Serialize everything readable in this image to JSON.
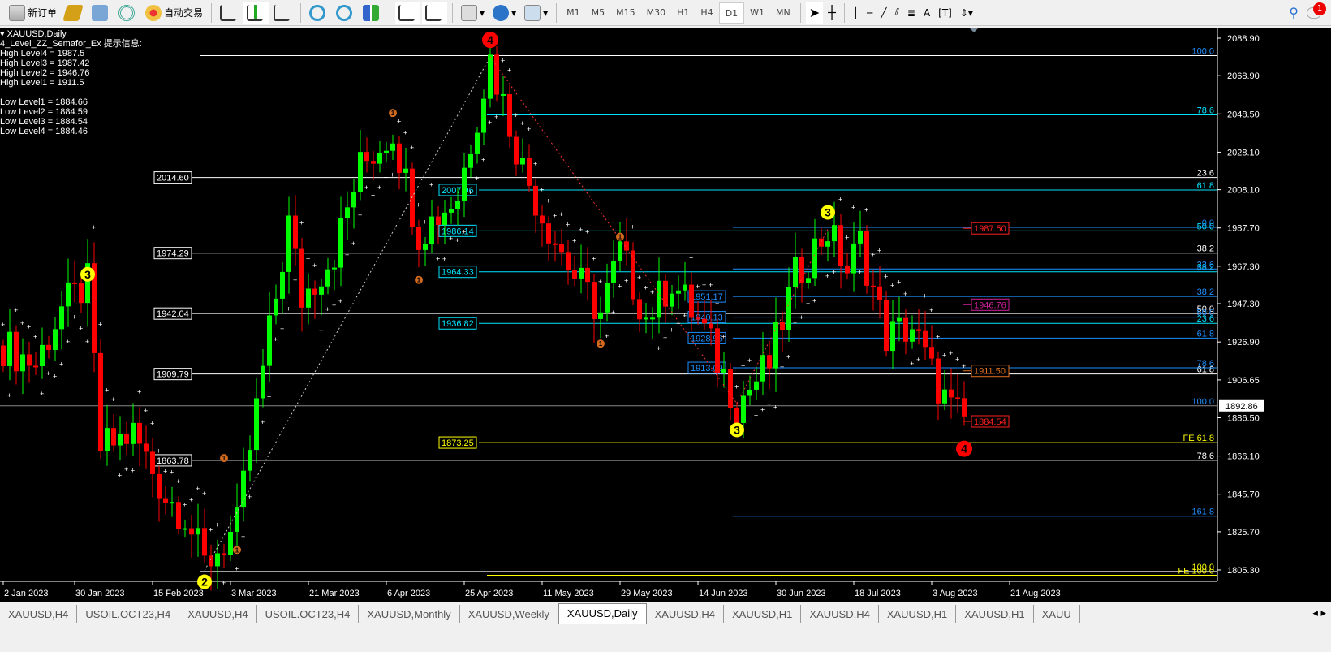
{
  "toolbar": {
    "new_order": "新订单",
    "auto_trading": "自动交易",
    "timeframes": [
      "M1",
      "M5",
      "M15",
      "M30",
      "H1",
      "H4",
      "D1",
      "W1",
      "MN"
    ],
    "active_timeframe": "D1",
    "notification_count": "1"
  },
  "info": {
    "symbol": "XAUUSD,Daily",
    "indicator": "4_Level_ZZ_Semafor_Ex 提示信息:",
    "lines": [
      "High Level4 = 1987.5",
      "High Level3 = 1987.42",
      "High Level2 = 1946.76",
      "High Level1 = 1911.5",
      "",
      "Low Level1 = 1884.66",
      "Low Level2 = 1884.59",
      "Low Level3 = 1884.54",
      "Low Level4 = 1884.46"
    ]
  },
  "colors": {
    "bull": "#00ff00",
    "bear": "#ff0000",
    "white_fib": "#ffffff",
    "cyan_fib": "#00ffff",
    "blue_fib": "#1e90ff",
    "yellow": "#ffff00"
  },
  "chart_data": {
    "type": "candlestick",
    "symbol": "XAUUSD",
    "timeframe": "Daily",
    "ylim": [
      1805.3,
      2088.9
    ],
    "y_ticks": [
      "2088.90",
      "2068.90",
      "2048.50",
      "2028.10",
      "2008.10",
      "1987.70",
      "1967.30",
      "1947.30",
      "1926.90",
      "1906.65",
      "1886.50",
      "1866.10",
      "1845.70",
      "1825.70",
      "1805.30"
    ],
    "x_ticks": [
      {
        "bar": 0,
        "label": "2 Jan 2023"
      },
      {
        "bar": 11,
        "label": "30 Jan 2023"
      },
      {
        "bar": 23,
        "label": "15 Feb 2023"
      },
      {
        "bar": 35,
        "label": "3 Mar 2023"
      },
      {
        "bar": 47,
        "label": "21 Mar 2023"
      },
      {
        "bar": 59,
        "label": "6 Apr 2023"
      },
      {
        "bar": 71,
        "label": "25 Apr 2023"
      },
      {
        "bar": 83,
        "label": "11 May 2023"
      },
      {
        "bar": 95,
        "label": "29 May 2023"
      },
      {
        "bar": 107,
        "label": "14 Jun 2023"
      },
      {
        "bar": 119,
        "label": "30 Jun 2023"
      },
      {
        "bar": 131,
        "label": "18 Jul 2023"
      },
      {
        "bar": 143,
        "label": "3 Aug 2023"
      },
      {
        "bar": 155,
        "label": "21 Aug 2023"
      }
    ],
    "swing_path": [
      [
        0,
        1925
      ],
      [
        5,
        1915
      ],
      [
        9,
        1945
      ],
      [
        13,
        1958
      ],
      [
        15,
        1870
      ],
      [
        20,
        1878
      ],
      [
        25,
        1845
      ],
      [
        28,
        1835
      ],
      [
        31,
        1808
      ],
      [
        36,
        1828
      ],
      [
        40,
        1912
      ],
      [
        44,
        1990
      ],
      [
        46,
        1950
      ],
      [
        51,
        1975
      ],
      [
        55,
        2020
      ],
      [
        60,
        2040
      ],
      [
        64,
        1985
      ],
      [
        70,
        2005
      ],
      [
        75,
        2078
      ],
      [
        80,
        2020
      ],
      [
        83,
        1995
      ],
      [
        88,
        1962
      ],
      [
        92,
        1942
      ],
      [
        95,
        1975
      ],
      [
        99,
        1940
      ],
      [
        103,
        1960
      ],
      [
        108,
        1932
      ],
      [
        113,
        1894
      ],
      [
        118,
        1915
      ],
      [
        122,
        1962
      ],
      [
        127,
        1987
      ],
      [
        130,
        1965
      ],
      [
        132,
        1980
      ],
      [
        136,
        1930
      ],
      [
        140,
        1935
      ],
      [
        143,
        1910
      ],
      [
        146,
        1890
      ],
      [
        148,
        1885
      ]
    ],
    "current_price": "1892.86",
    "white_fib": {
      "levels": [
        {
          "price": 2014.6,
          "label": "2014.60",
          "pct": "23.6"
        },
        {
          "price": 1974.29,
          "label": "1974.29",
          "pct": "38.2"
        },
        {
          "price": 1942.04,
          "label": "1942.04",
          "pct": "50.0"
        },
        {
          "price": 1909.79,
          "label": "1909.79",
          "pct": "61.8"
        },
        {
          "price": 1863.78,
          "label": "1863.78",
          "pct": "78.6"
        }
      ],
      "top": {
        "price": 2079.6,
        "pct": "100.0"
      },
      "bottom": {
        "price": 1804.5,
        "pct": "100.0"
      }
    },
    "cyan_fib": [
      {
        "price": 2048.0,
        "pct": "78.6"
      },
      {
        "price": 2007.96,
        "label": "2007.96",
        "pct": "61.8"
      },
      {
        "price": 1986.14,
        "label": "1986.14",
        "pct": "50.0"
      },
      {
        "price": 1964.33,
        "label": "1964.33",
        "pct": "38.2"
      },
      {
        "price": 1936.82,
        "label": "1936.82",
        "pct": "23.6"
      }
    ],
    "blue_fib": [
      {
        "price": 1988.0,
        "pct": "0.0"
      },
      {
        "price": 1965.8,
        "pct": "23.6"
      },
      {
        "price": 1951.17,
        "label": "1951.17",
        "pct": "38.2"
      },
      {
        "price": 1940.13,
        "label": "1940.13",
        "pct": "50.0"
      },
      {
        "price": 1928.96,
        "label": "1928.96",
        "pct": "61.8"
      },
      {
        "price": 1913.09,
        "label": "1913.09",
        "pct": "78.6"
      },
      {
        "price": 1892.86,
        "pct": "100.0"
      },
      {
        "price": 1834.0,
        "pct": "161.8"
      }
    ],
    "fe_levels": [
      {
        "price": 1873.25,
        "label": "1873.25",
        "pct": "FE 61.8"
      },
      {
        "price": 1802.5,
        "pct": "FE 100.0"
      }
    ],
    "level_boxes": [
      {
        "price": 1987.5,
        "label": "1987.50",
        "color": "#ff2020"
      },
      {
        "price": 1946.76,
        "label": "1946.76",
        "color": "#d0209a"
      },
      {
        "price": 1911.5,
        "label": "1911.50",
        "color": "#e07020"
      },
      {
        "price": 1884.54,
        "label": "1884.54",
        "color": "#ff2020"
      }
    ],
    "semafor": [
      {
        "bar": 75,
        "price": 2088,
        "n": "4",
        "color": "#ff0000"
      },
      {
        "bar": 148,
        "price": 1870,
        "n": "4",
        "color": "#ff0000"
      },
      {
        "bar": 13,
        "price": 1963,
        "n": "3",
        "color": "#ffff00"
      },
      {
        "bar": 127,
        "price": 1996,
        "n": "3",
        "color": "#ffff00"
      },
      {
        "bar": 113,
        "price": 1880,
        "n": "3",
        "color": "#ffff00"
      },
      {
        "bar": 31,
        "price": 1799,
        "n": "2",
        "color": "#ffff00"
      },
      {
        "bar": 60,
        "price": 2049,
        "n": "1",
        "color": "#d2691e"
      },
      {
        "bar": 64,
        "price": 1960,
        "n": "1",
        "color": "#d2691e"
      },
      {
        "bar": 95,
        "price": 1983,
        "n": "1",
        "color": "#d2691e"
      },
      {
        "bar": 92,
        "price": 1926,
        "n": "1",
        "color": "#d2691e"
      },
      {
        "bar": 34,
        "price": 1865,
        "n": "1",
        "color": "#d2691e"
      },
      {
        "bar": 36,
        "price": 1816,
        "n": "1",
        "color": "#d2691e"
      }
    ]
  },
  "tabs": [
    "XAUUSD,H4",
    "USOIL.OCT23,H4",
    "XAUUSD,H4",
    "USOIL.OCT23,H4",
    "XAUUSD,Monthly",
    "XAUUSD,Weekly",
    "XAUUSD,Daily",
    "XAUUSD,H4",
    "XAUUSD,H1",
    "XAUUSD,H4",
    "XAUUSD,H1",
    "XAUUSD,H1",
    "XAUU"
  ],
  "active_tab": "XAUUSD,Daily"
}
